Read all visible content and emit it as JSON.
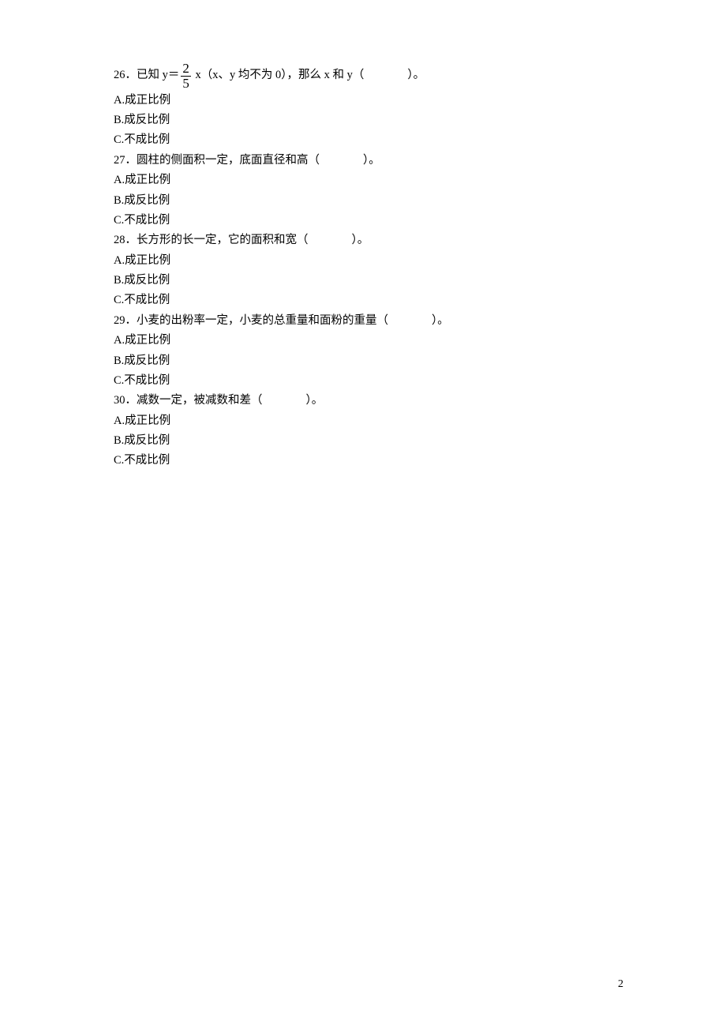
{
  "page_number": "2",
  "questions": [
    {
      "num": "26．",
      "stem_a": "已知 y＝",
      "frac_num": "2",
      "frac_den": "5",
      "stem_b": " x（x、y 均不为 0），那么 x 和 y（",
      "stem_c": "）。",
      "options": [
        "A.成正比例",
        "B.成反比例",
        "C.不成比例"
      ]
    },
    {
      "num": "27．",
      "stem_a": "圆柱的侧面积一定，底面直径和高（",
      "stem_c": "）。",
      "options": [
        "A.成正比例",
        "B.成反比例",
        "C.不成比例"
      ]
    },
    {
      "num": "28．",
      "stem_a": "长方形的长一定，它的面积和宽（",
      "stem_c": "）。",
      "options": [
        "A.成正比例",
        "B.成反比例",
        "C.不成比例"
      ]
    },
    {
      "num": "29．",
      "stem_a": "小麦的出粉率一定，小麦的总重量和面粉的重量（",
      "stem_c": "）。",
      "options": [
        "A.成正比例",
        "B.成反比例",
        "C.不成比例"
      ]
    },
    {
      "num": "30．",
      "stem_a": "减数一定，被减数和差（",
      "stem_c": "）。",
      "options": [
        "A.成正比例",
        "B.成反比例",
        "C.不成比例"
      ]
    }
  ]
}
